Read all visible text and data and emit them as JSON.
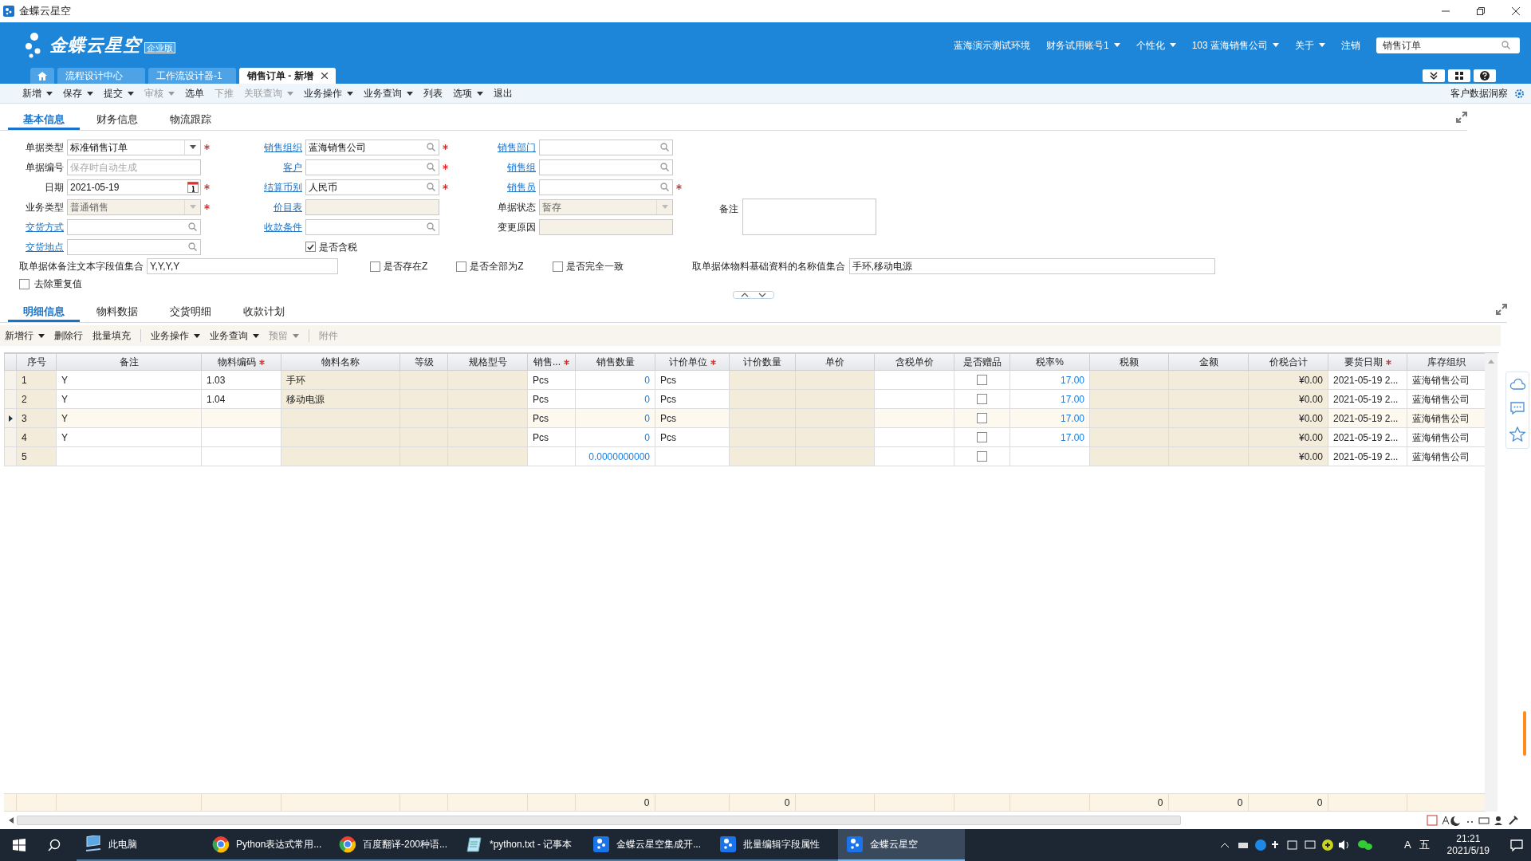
{
  "title_bar": {
    "title": "金蝶云星空"
  },
  "header": {
    "logo": "金蝶云星空",
    "edition": "企业版",
    "nav": [
      {
        "label": "蓝海演示测试环境",
        "dropdown": false
      },
      {
        "label": "财务试用账号1",
        "dropdown": true
      },
      {
        "label": "个性化",
        "dropdown": true
      },
      {
        "code": "103",
        "label": "蓝海销售公司",
        "dropdown": true
      },
      {
        "label": "关于",
        "dropdown": true
      },
      {
        "label": "注销",
        "dropdown": false
      }
    ],
    "search": {
      "value": "销售订单"
    }
  },
  "page_tabs": [
    {
      "kind": "home",
      "selected": false
    },
    {
      "kind": "page",
      "label": "流程设计中心",
      "selected": false
    },
    {
      "kind": "page",
      "label": "工作流设计器-1",
      "selected": false
    },
    {
      "kind": "page",
      "label": "销售订单 - 新增",
      "selected": true
    }
  ],
  "toolbar": {
    "items": [
      {
        "label": "新增",
        "dropdown": true,
        "disabled": false
      },
      {
        "label": "保存",
        "dropdown": true,
        "disabled": false
      },
      {
        "label": "提交",
        "dropdown": true,
        "disabled": false
      },
      {
        "label": "审核",
        "dropdown": true,
        "disabled": true
      },
      {
        "label": "选单",
        "dropdown": false,
        "disabled": false
      },
      {
        "label": "下推",
        "dropdown": false,
        "disabled": true
      },
      {
        "label": "关联查询",
        "dropdown": true,
        "disabled": true
      },
      {
        "label": "业务操作",
        "dropdown": true,
        "disabled": false
      },
      {
        "label": "业务查询",
        "dropdown": true,
        "disabled": false
      },
      {
        "label": "列表",
        "dropdown": false,
        "disabled": false
      },
      {
        "label": "选项",
        "dropdown": true,
        "disabled": false
      },
      {
        "label": "退出",
        "dropdown": false,
        "disabled": false
      }
    ],
    "right": {
      "label": "客户数据洞察"
    }
  },
  "form_tabs": [
    {
      "label": "基本信息",
      "selected": true
    },
    {
      "label": "财务信息",
      "selected": false
    },
    {
      "label": "物流跟踪",
      "selected": false
    }
  ],
  "form": {
    "columns": [
      [
        {
          "label": "单据类型",
          "link": false,
          "kind": "dropdown",
          "value": "标准销售订单",
          "required": true,
          "disabled": false
        },
        {
          "label": "单据编号",
          "link": false,
          "kind": "text",
          "placeholder": "保存时自动生成",
          "required": false,
          "disabled": false
        },
        {
          "label": "日期",
          "link": false,
          "kind": "date",
          "value": "2021-05-19",
          "required": true,
          "disabled": false
        },
        {
          "label": "业务类型",
          "link": false,
          "kind": "dropdown",
          "value": "普通销售",
          "required": true,
          "disabled": true
        },
        {
          "label": "交货方式",
          "link": true,
          "kind": "lookup",
          "required": false,
          "disabled": false
        },
        {
          "label": "交货地点",
          "link": true,
          "kind": "lookup",
          "required": false,
          "disabled": false
        }
      ],
      [
        {
          "label": "销售组织",
          "link": true,
          "kind": "lookup",
          "value": "蓝海销售公司",
          "required": true,
          "disabled": false
        },
        {
          "label": "客户",
          "link": true,
          "kind": "lookup",
          "required": true,
          "disabled": false
        },
        {
          "label": "结算币别",
          "link": true,
          "kind": "lookup",
          "value": "人民币",
          "required": true,
          "disabled": false
        },
        {
          "label": "价目表",
          "link": true,
          "kind": "text",
          "required": false,
          "disabled": true
        },
        {
          "label": "收款条件",
          "link": true,
          "kind": "lookup",
          "required": false,
          "disabled": false
        },
        {
          "label": "是否含税",
          "kind": "checkbox",
          "checked": true
        }
      ],
      [
        {
          "label": "销售部门",
          "link": true,
          "kind": "lookup",
          "required": false,
          "disabled": false
        },
        {
          "label": "销售组",
          "link": true,
          "kind": "lookup",
          "required": false,
          "disabled": false
        },
        {
          "label": "销售员",
          "link": true,
          "kind": "lookup",
          "required": true,
          "disabled": false
        },
        {
          "label": "单据状态",
          "link": false,
          "kind": "dropdown",
          "value": "暂存",
          "required": false,
          "disabled": true
        },
        {
          "label": "变更原因",
          "link": false,
          "kind": "text",
          "required": false,
          "disabled": true
        }
      ]
    ],
    "remark": {
      "label": "备注"
    },
    "note_field": {
      "label": "取单据体备注文本字段值集合",
      "value": "Y,Y,Y,Y"
    },
    "options": [
      {
        "label": "是否存在Z",
        "checked": false
      },
      {
        "label": "是否全部为Z",
        "checked": false
      },
      {
        "label": "是否完全一致",
        "checked": false
      }
    ],
    "name_field": {
      "label": "取单据体物料基础资料的名称值集合",
      "value": "手环,移动电源"
    },
    "dedupe": {
      "label": "去除重复值",
      "checked": false
    }
  },
  "detail_tabs": [
    {
      "label": "明细信息",
      "selected": true
    },
    {
      "label": "物料数据",
      "selected": false
    },
    {
      "label": "交货明细",
      "selected": false
    },
    {
      "label": "收款计划",
      "selected": false
    }
  ],
  "detail_toolbar": [
    {
      "kind": "button",
      "label": "新增行",
      "dropdown": true,
      "disabled": false
    },
    {
      "kind": "button",
      "label": "删除行",
      "dropdown": false,
      "disabled": false
    },
    {
      "kind": "button",
      "label": "批量填充",
      "dropdown": false,
      "disabled": false
    },
    {
      "kind": "separator"
    },
    {
      "kind": "button",
      "label": "业务操作",
      "dropdown": true,
      "disabled": false
    },
    {
      "kind": "button",
      "label": "业务查询",
      "dropdown": true,
      "disabled": false
    },
    {
      "kind": "button",
      "label": "预留",
      "dropdown": true,
      "disabled": true
    },
    {
      "kind": "separator"
    },
    {
      "kind": "button",
      "label": "附件",
      "dropdown": false,
      "disabled": true
    }
  ],
  "table": {
    "columns": [
      {
        "label": "序号",
        "kind": "text",
        "readonly": true,
        "required": false
      },
      {
        "label": "备注",
        "kind": "text",
        "readonly": false,
        "required": false
      },
      {
        "label": "物料编码",
        "kind": "text",
        "readonly": false,
        "required": true
      },
      {
        "label": "物料名称",
        "kind": "text",
        "readonly": true,
        "required": false
      },
      {
        "label": "等级",
        "kind": "text",
        "readonly": true,
        "required": false
      },
      {
        "label": "规格型号",
        "kind": "text",
        "readonly": true,
        "required": false
      },
      {
        "label": "销售...",
        "kind": "text",
        "readonly": false,
        "required": true
      },
      {
        "label": "销售数量",
        "kind": "qty",
        "readonly": false,
        "required": false,
        "total": "0"
      },
      {
        "label": "计价单位",
        "kind": "text",
        "readonly": false,
        "required": true
      },
      {
        "label": "计价数量",
        "kind": "amount",
        "readonly": true,
        "required": false,
        "total": "0"
      },
      {
        "label": "单价",
        "kind": "amount",
        "readonly": true,
        "required": false
      },
      {
        "label": "含税单价",
        "kind": "amount",
        "readonly": false,
        "required": false
      },
      {
        "label": "是否赠品",
        "kind": "check",
        "readonly": false,
        "required": false
      },
      {
        "label": "税率%",
        "kind": "qty",
        "readonly": false,
        "required": false
      },
      {
        "label": "税额",
        "kind": "amount",
        "readonly": true,
        "required": false,
        "total": "0"
      },
      {
        "label": "金额",
        "kind": "amount",
        "readonly": true,
        "required": false,
        "total": "0"
      },
      {
        "label": "价税合计",
        "kind": "amount",
        "readonly": true,
        "required": false,
        "total": "0"
      },
      {
        "label": "要货日期",
        "kind": "text",
        "readonly": false,
        "required": true
      },
      {
        "label": "库存组织",
        "kind": "text",
        "readonly": false,
        "required": false
      }
    ],
    "rows": [
      {
        "current": false,
        "cells": [
          "1",
          "Y",
          "1.03",
          "手环",
          null,
          null,
          "Pcs",
          "0",
          "Pcs",
          null,
          null,
          null,
          false,
          "17.00",
          null,
          null,
          "¥0.00",
          "2021-05-19 2...",
          "蓝海销售公司"
        ]
      },
      {
        "current": false,
        "cells": [
          "2",
          "Y",
          "1.04",
          "移动电源",
          null,
          null,
          "Pcs",
          "0",
          "Pcs",
          null,
          null,
          null,
          false,
          "17.00",
          null,
          null,
          "¥0.00",
          "2021-05-19 2...",
          "蓝海销售公司"
        ]
      },
      {
        "current": true,
        "cells": [
          "3",
          "Y",
          null,
          null,
          null,
          null,
          "Pcs",
          "0",
          "Pcs",
          null,
          null,
          null,
          false,
          "17.00",
          null,
          null,
          "¥0.00",
          "2021-05-19 2...",
          "蓝海销售公司"
        ]
      },
      {
        "current": false,
        "cells": [
          "4",
          "Y",
          null,
          null,
          null,
          null,
          "Pcs",
          "0",
          "Pcs",
          null,
          null,
          null,
          false,
          "17.00",
          null,
          null,
          "¥0.00",
          "2021-05-19 2...",
          "蓝海销售公司"
        ]
      },
      {
        "current": false,
        "cells": [
          "5",
          null,
          null,
          null,
          null,
          null,
          null,
          "0.0000000000",
          null,
          null,
          null,
          null,
          false,
          null,
          null,
          null,
          "¥0.00",
          "2021-05-19 2...",
          "蓝海销售公司"
        ]
      }
    ]
  },
  "taskbar": {
    "items": [
      {
        "kind": "computer",
        "label": "此电脑",
        "active": false
      },
      {
        "kind": "browser",
        "label": "Python表达式常用...",
        "active": false
      },
      {
        "kind": "browser",
        "label": "百度翻译-200种语...",
        "active": false
      },
      {
        "kind": "notepad",
        "label": "*python.txt - 记事本",
        "active": false
      },
      {
        "kind": "app",
        "label": "金蝶云星空集成开...",
        "active": false
      },
      {
        "kind": "app",
        "label": "批量编辑字段属性",
        "active": false
      },
      {
        "kind": "app",
        "label": "金蝶云星空",
        "active": true
      }
    ],
    "ime": [
      "A",
      "五"
    ],
    "time": "21:21",
    "date": "2021/5/19"
  }
}
